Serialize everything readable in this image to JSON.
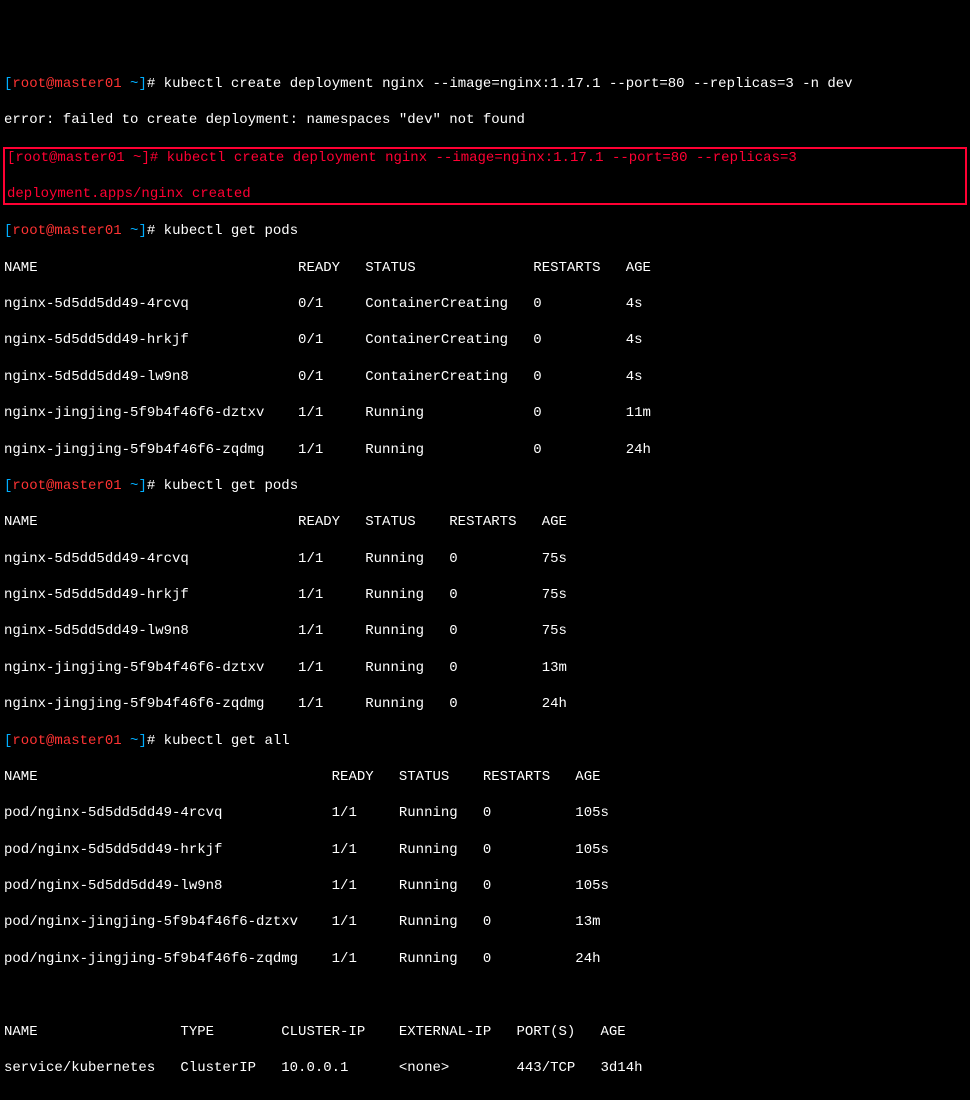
{
  "prompt": {
    "open": "[",
    "user": "root",
    "at": "@",
    "host": "master01",
    "space": " ",
    "tilde": "~",
    "close": "]",
    "hash": "# "
  },
  "cmd1": "kubectl create deployment nginx --image=nginx:1.17.1 --port=80 --replicas=3 -n dev",
  "err1": "error: failed to create deployment: namespaces \"dev\" not found",
  "cmd2": "kubectl create deployment nginx --image=nginx:1.17.1 --port=80 --replicas=3",
  "out2": "deployment.apps/nginx created",
  "cmd3": "kubectl get pods",
  "pods1_header": "NAME                               READY   STATUS              RESTARTS   AGE",
  "pods1_rows": [
    "nginx-5d5dd5dd49-4rcvq             0/1     ContainerCreating   0          4s",
    "nginx-5d5dd5dd49-hrkjf             0/1     ContainerCreating   0          4s",
    "nginx-5d5dd5dd49-lw9n8             0/1     ContainerCreating   0          4s",
    "nginx-jingjing-5f9b4f46f6-dztxv    1/1     Running             0          11m",
    "nginx-jingjing-5f9b4f46f6-zqdmg    1/1     Running             0          24h"
  ],
  "cmd4": "kubectl get pods",
  "pods2_header": "NAME                               READY   STATUS    RESTARTS   AGE",
  "pods2_rows": [
    "nginx-5d5dd5dd49-4rcvq             1/1     Running   0          75s",
    "nginx-5d5dd5dd49-hrkjf             1/1     Running   0          75s",
    "nginx-5d5dd5dd49-lw9n8             1/1     Running   0          75s",
    "nginx-jingjing-5f9b4f46f6-dztxv    1/1     Running   0          13m",
    "nginx-jingjing-5f9b4f46f6-zqdmg    1/1     Running   0          24h"
  ],
  "cmd5": "kubectl get all",
  "all_header": "NAME                                   READY   STATUS    RESTARTS   AGE",
  "all_rows": [
    "pod/nginx-5d5dd5dd49-4rcvq             1/1     Running   0          105s",
    "pod/nginx-5d5dd5dd49-hrkjf             1/1     Running   0          105s",
    "pod/nginx-5d5dd5dd49-lw9n8             1/1     Running   0          105s",
    "pod/nginx-jingjing-5f9b4f46f6-dztxv    1/1     Running   0          13m",
    "pod/nginx-jingjing-5f9b4f46f6-zqdmg    1/1     Running   0          24h"
  ],
  "svc_header": "NAME                 TYPE        CLUSTER-IP    EXTERNAL-IP   PORT(S)   AGE",
  "svc_rows": [
    "service/kubernetes   ClusterIP   10.0.0.1      <none>        443/TCP   3d14h"
  ]
}
